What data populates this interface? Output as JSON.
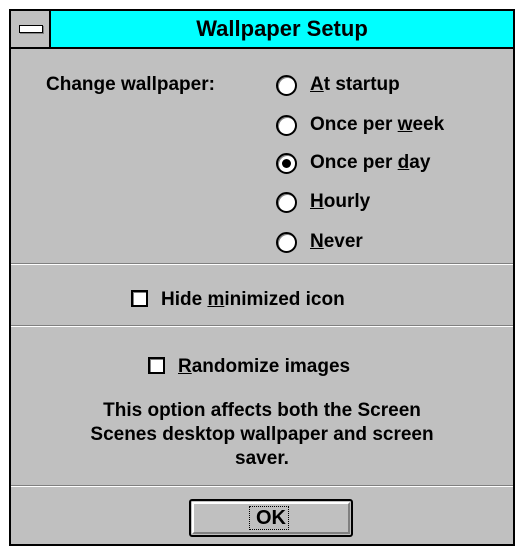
{
  "window": {
    "title": "Wallpaper Setup"
  },
  "change_wallpaper": {
    "label": "Change wallpaper:",
    "options": [
      {
        "prefix": "",
        "accel": "A",
        "suffix": "t startup",
        "selected": false
      },
      {
        "prefix": "Once per ",
        "accel": "w",
        "suffix": "eek",
        "selected": false
      },
      {
        "prefix": "Once per ",
        "accel": "d",
        "suffix": "ay",
        "selected": true
      },
      {
        "prefix": "",
        "accel": "H",
        "suffix": "ourly",
        "selected": false
      },
      {
        "prefix": "",
        "accel": "N",
        "suffix": "ever",
        "selected": false
      }
    ]
  },
  "hide_minimized": {
    "prefix": "Hide ",
    "accel": "m",
    "suffix": "inimized icon",
    "checked": false
  },
  "randomize": {
    "prefix": "",
    "accel": "R",
    "suffix": "andomize images",
    "checked": false
  },
  "note": {
    "line1": "This option affects both the Screen",
    "line2": "Scenes desktop wallpaper and screen",
    "line3": "saver."
  },
  "ok_button": {
    "label": "OK"
  }
}
